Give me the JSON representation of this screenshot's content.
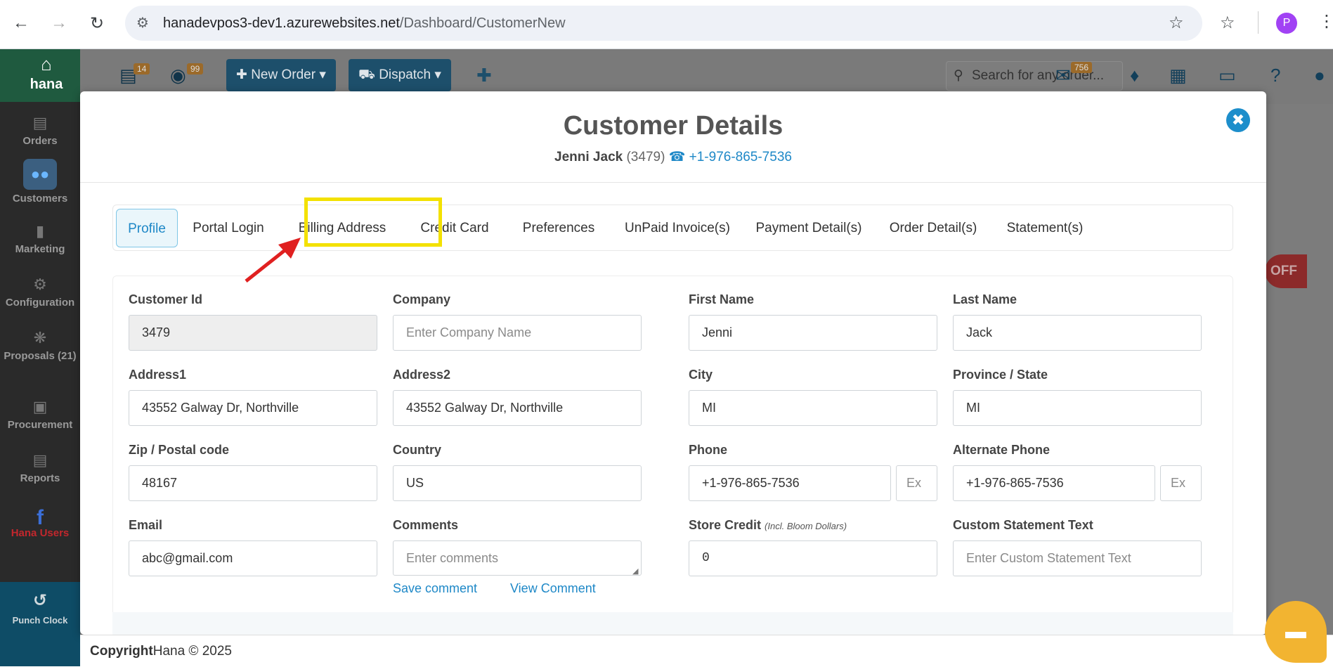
{
  "browser": {
    "url_host": "hanadevpos3-dev1.azurewebsites.net",
    "url_path": "/Dashboard/CustomerNew",
    "avatar_letter": "P"
  },
  "app": {
    "brand": "hana",
    "nav": [
      {
        "label": "Orders",
        "icon": "orders-icon"
      },
      {
        "label": "Customers",
        "icon": "users-icon"
      },
      {
        "label": "Marketing",
        "icon": "chart-icon"
      },
      {
        "label": "Configuration",
        "icon": "gear-icon"
      },
      {
        "label": "Proposals (21)",
        "icon": "proposals-icon"
      },
      {
        "label": "Procurement",
        "icon": "procurement-icon"
      },
      {
        "label": "Reports",
        "icon": "reports-icon"
      },
      {
        "label": "Hana Users",
        "icon": "facebook-icon"
      }
    ],
    "punch_clock": "Punch Clock",
    "top": {
      "badge_orders": "14",
      "badge_messages": "99",
      "new_order": "New Order",
      "dispatch": "Dispatch",
      "search_placeholder": "Search for any order...",
      "badge_mail": "756"
    },
    "bg_button": "OFF",
    "footer_bold": "Copyright",
    "footer_rest": "Hana © 2025"
  },
  "modal": {
    "title": "Customer Details",
    "customer_name": "Jenni Jack",
    "customer_id_paren": "(3479)",
    "customer_phone": "+1-976-865-7536",
    "tabs": [
      "Profile",
      "Portal Login",
      "Billing Address",
      "Credit Card",
      "Preferences",
      "UnPaid Invoice(s)",
      "Payment Detail(s)",
      "Order Detail(s)",
      "Statement(s)"
    ],
    "fields": {
      "customer_id": {
        "label": "Customer Id",
        "value": "3479"
      },
      "company": {
        "label": "Company",
        "placeholder": "Enter Company Name"
      },
      "first_name": {
        "label": "First Name",
        "value": "Jenni"
      },
      "last_name": {
        "label": "Last Name",
        "value": "Jack"
      },
      "address1": {
        "label": "Address1",
        "value": "43552 Galway Dr, Northville"
      },
      "address2": {
        "label": "Address2",
        "value": "43552 Galway Dr, Northville"
      },
      "city": {
        "label": "City",
        "value": "MI"
      },
      "province": {
        "label": "Province / State",
        "value": "MI"
      },
      "zip": {
        "label": "Zip / Postal code",
        "value": "48167"
      },
      "country": {
        "label": "Country",
        "value": "US"
      },
      "phone": {
        "label": "Phone",
        "value": "+1-976-865-7536",
        "ext_placeholder": "Ex"
      },
      "alt_phone": {
        "label": "Alternate Phone",
        "value": "+1-976-865-7536",
        "ext_placeholder": "Ex"
      },
      "email": {
        "label": "Email",
        "value": "abc@gmail.com"
      },
      "comments": {
        "label": "Comments",
        "placeholder": "Enter comments"
      },
      "store_credit": {
        "label": "Store Credit",
        "note": "(Incl. Bloom Dollars)",
        "value": "0"
      },
      "custom_statement": {
        "label": "Custom Statement Text",
        "placeholder": "Enter Custom Statement Text"
      }
    },
    "save_comment": "Save comment",
    "view_comment": "View Comment"
  },
  "colors": {
    "accent": "#1e88c7",
    "highlight": "#f3e100",
    "arrow": "#e02020"
  }
}
